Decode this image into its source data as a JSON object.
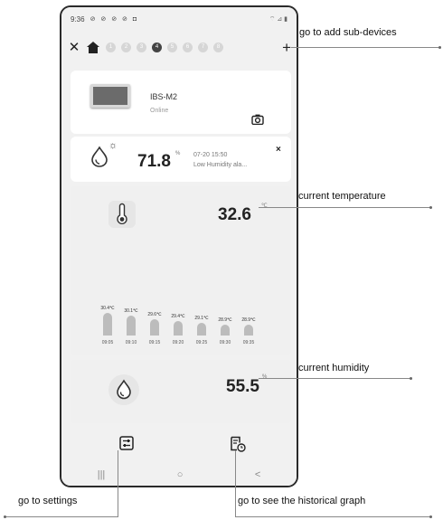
{
  "status_bar": {
    "time": "9:36",
    "icons": "⊘ ⊘ ⊘ ⊘ ◘",
    "right": "⌔ ⊿ ▮"
  },
  "tabs": [
    "1",
    "2",
    "3",
    "4",
    "5",
    "6",
    "7",
    "8"
  ],
  "device": {
    "name": "IBS-M2",
    "status": "Online"
  },
  "alert": {
    "value": "71.8",
    "unit": "%",
    "time": "07-20 15:50",
    "message": "Low Humidity ala...",
    "close": "×"
  },
  "temperature": {
    "value": "32.6",
    "unit": "℃",
    "chart_data": {
      "type": "bar",
      "categories": [
        "09:05",
        "09:10",
        "09:15",
        "09:20",
        "09:25",
        "09:30",
        "09:35"
      ],
      "values": [
        30.4,
        30.1,
        29.6,
        29.4,
        29.1,
        28.9,
        28.9
      ],
      "labels": [
        "30.4℃",
        "30.1℃",
        "29.6℃",
        "29.4℃",
        "29.1℃",
        "28.9℃",
        "28.9℃"
      ]
    }
  },
  "humidity": {
    "value": "55.5",
    "unit": "%"
  },
  "navbar": {
    "recents": "|||",
    "home": "○",
    "back": "<"
  },
  "annotations": {
    "add_sub_devices": "go to add sub-devices",
    "current_temperature": "current temperature",
    "current_humidity": "current humidity",
    "settings": "go to settings",
    "historical_graph": "go to see the historical graph"
  },
  "colors": {
    "bar": "#bcbcbc",
    "active_tab": "#444444",
    "inactive_tab": "#d6d6d6"
  }
}
